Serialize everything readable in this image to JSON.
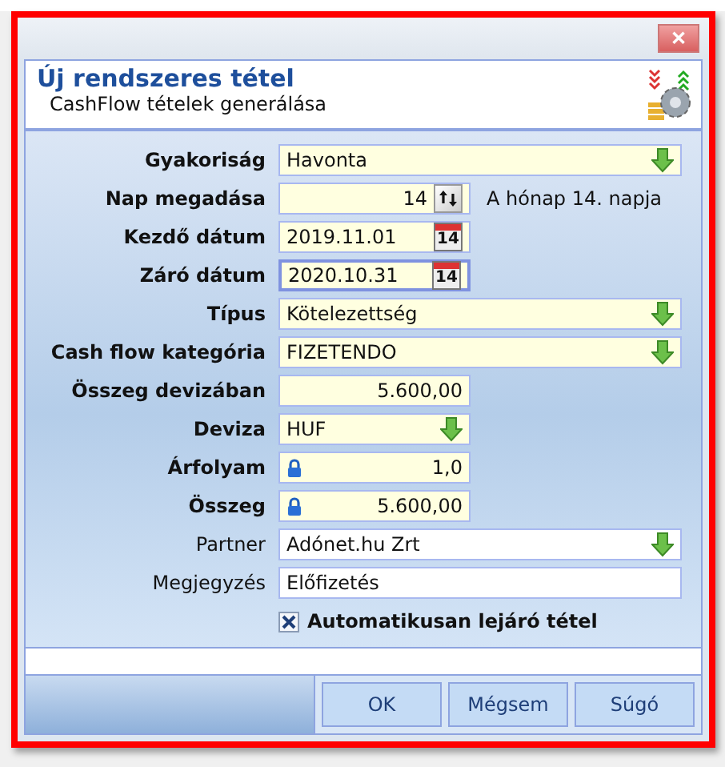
{
  "window": {
    "close": "✕"
  },
  "header": {
    "title": "Új rendszeres tétel",
    "subtitle": "CashFlow tételek generálása"
  },
  "fields": [
    {
      "label": "Gyakoriság",
      "required": true,
      "kind": "dropdown",
      "wide": true,
      "value": "Havonta"
    },
    {
      "label": "Nap megadása",
      "required": true,
      "kind": "spinner",
      "wide": false,
      "value": "14",
      "note": "A hónap 14. napja"
    },
    {
      "label": "Kezdő dátum",
      "required": true,
      "kind": "date",
      "wide": false,
      "value": "2019.11.01",
      "calendar_day": "14",
      "focused": false
    },
    {
      "label": "Záró dátum",
      "required": true,
      "kind": "date",
      "wide": false,
      "value": "2020.10.31",
      "calendar_day": "14",
      "focused": true
    },
    {
      "label": "Típus",
      "required": true,
      "kind": "dropdown",
      "wide": true,
      "value": "Kötelezettség"
    },
    {
      "label": "Cash flow kategória",
      "required": true,
      "kind": "dropdown",
      "wide": true,
      "value": "FIZETENDO"
    },
    {
      "label": "Összeg devizában",
      "required": true,
      "kind": "number",
      "wide": false,
      "value": "5.600,00",
      "locked": false
    },
    {
      "label": "Deviza",
      "required": true,
      "kind": "dropdown",
      "wide": false,
      "value": "HUF"
    },
    {
      "label": "Árfolyam",
      "required": true,
      "kind": "number",
      "wide": false,
      "value": "1,0",
      "locked": true
    },
    {
      "label": "Összeg",
      "required": true,
      "kind": "number",
      "wide": false,
      "value": "5.600,00",
      "locked": true
    },
    {
      "label": "Partner",
      "required": false,
      "kind": "dropdown",
      "wide": true,
      "value": "Adónet.hu Zrt"
    },
    {
      "label": "Megjegyzés",
      "required": false,
      "kind": "text",
      "wide": true,
      "value": "Előfizetés"
    }
  ],
  "auto_expire": {
    "label": "Automatikusan lejáró tétel",
    "checked": true
  },
  "buttons": [
    "OK",
    "Mégsem",
    "Súgó"
  ]
}
